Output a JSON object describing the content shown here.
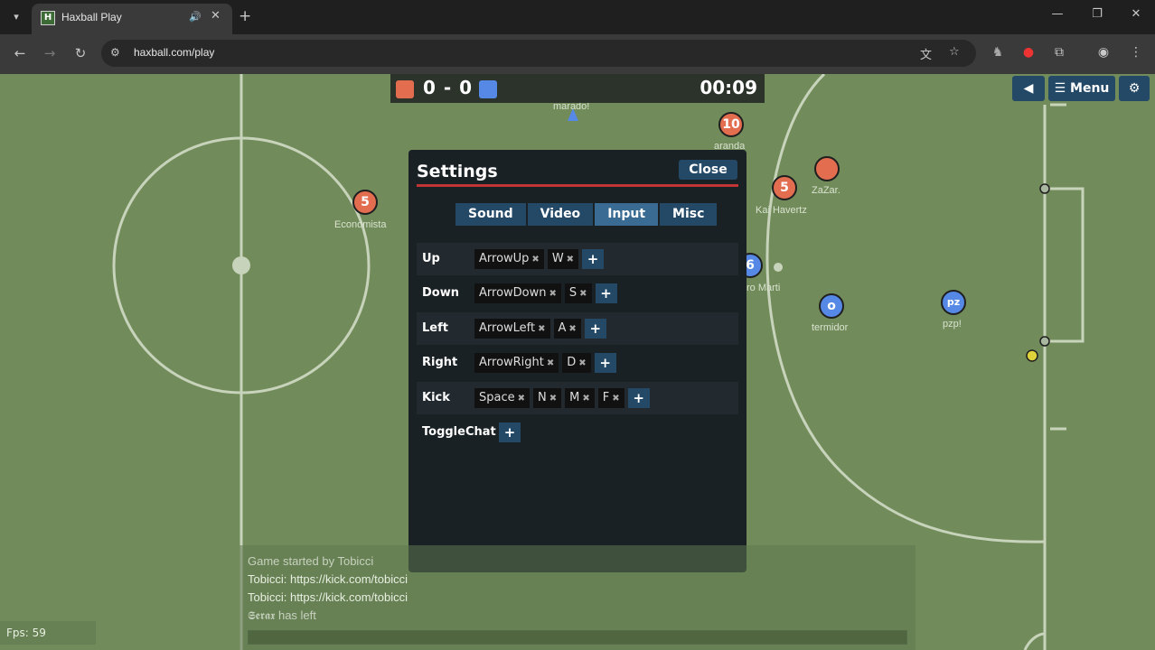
{
  "browser": {
    "tab_title": "Haxball Play",
    "tab_favicon_letter": "H",
    "url": "haxball.com/play",
    "icons": [
      "tab-search-icon",
      "audio-icon",
      "close-icon",
      "plus-icon",
      "minimize-icon",
      "restore-icon",
      "window-close-icon",
      "back-icon",
      "forward-icon",
      "reload-icon",
      "site-info-icon",
      "translate-icon",
      "star-icon",
      "extensions-icon",
      "profile-icon",
      "more-icon"
    ]
  },
  "scoreboard": {
    "score": "0 - 0",
    "time": "00:09",
    "red_color": "#e26e4f",
    "blue_color": "#5689e5"
  },
  "top_menu": {
    "menu_label": "Menu"
  },
  "players": [
    {
      "num": "10",
      "name": "aranda",
      "team": "red"
    },
    {
      "num": "5",
      "name": "Economista",
      "team": "red"
    },
    {
      "num": "5",
      "name": "Kai Havertz",
      "team": "red"
    },
    {
      "num": "",
      "name": "ZaZar.",
      "team": "red"
    },
    {
      "num": "6",
      "name": "ro Marti",
      "team": "blue"
    },
    {
      "num": "o",
      "name": "termidor",
      "team": "blue"
    },
    {
      "num": "pz",
      "name": "pzp!",
      "team": "blue"
    },
    {
      "num": "",
      "name": "marado!",
      "team": "blue"
    }
  ],
  "settings": {
    "title": "Settings",
    "close_label": "Close",
    "tabs": [
      "Sound",
      "Video",
      "Input",
      "Misc"
    ],
    "active_tab": "Input",
    "bindings": [
      {
        "action": "Up",
        "keys": [
          "ArrowUp",
          "W"
        ]
      },
      {
        "action": "Down",
        "keys": [
          "ArrowDown",
          "S"
        ]
      },
      {
        "action": "Left",
        "keys": [
          "ArrowLeft",
          "A"
        ]
      },
      {
        "action": "Right",
        "keys": [
          "ArrowRight",
          "D"
        ]
      },
      {
        "action": "Kick",
        "keys": [
          "Space",
          "N",
          "M",
          "F"
        ]
      },
      {
        "action": "ToggleChat",
        "keys": []
      }
    ],
    "remove_glyph": "✖",
    "add_glyph": "+"
  },
  "chat": {
    "lines": [
      "Game started by Tobicci",
      "Tobicci: https://kick.com/tobicci",
      "Tobicci: https://kick.com/tobicci",
      "𝕾𝖊𝖗𝖆𝖝 has left"
    ]
  },
  "fps": "Fps: 59",
  "colors": {
    "field": "#718c5a",
    "button": "#244967",
    "active_tab": "#3a6c93",
    "dialog": "#1a2125",
    "accent_line": "#c13535"
  }
}
